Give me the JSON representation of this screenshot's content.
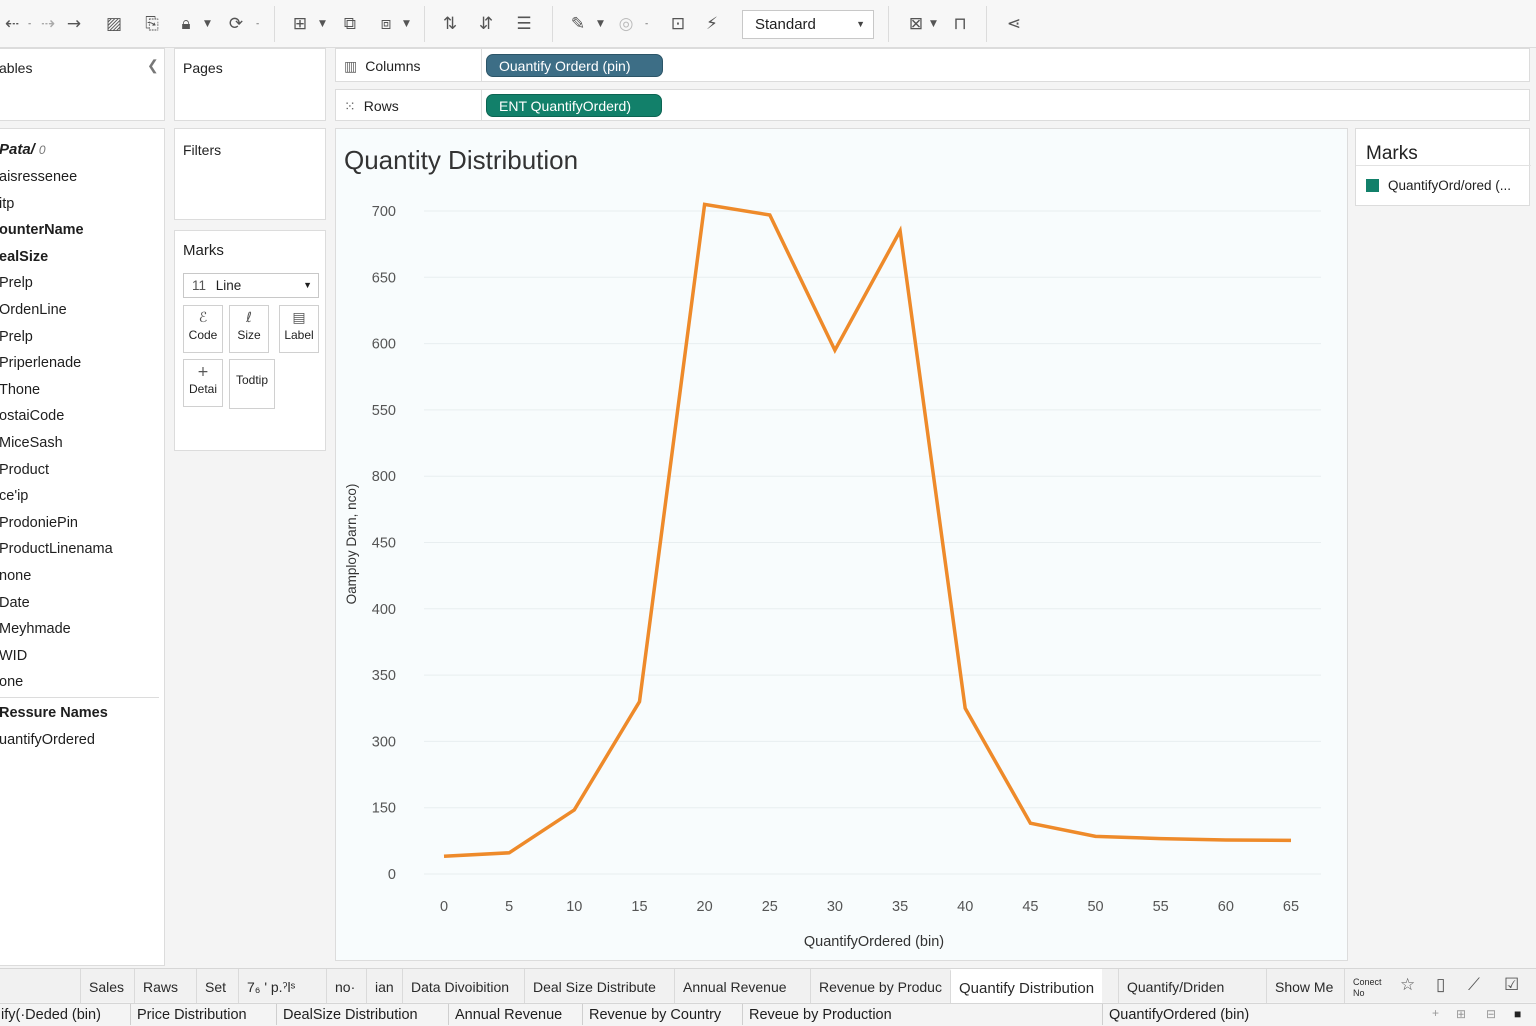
{
  "toolbar": {
    "view_mode": "Standard"
  },
  "data_pane": {
    "title": "ables",
    "section_header": "Pata/",
    "section_suffix": "0",
    "dimensions": [
      {
        "label": "aisressenee",
        "bold": false
      },
      {
        "label": "itp",
        "bold": false
      },
      {
        "label": "ounterName",
        "bold": true
      },
      {
        "label": "ealSize",
        "bold": true
      },
      {
        "label": "Prelp",
        "bold": false
      },
      {
        "label": "OrdenLine",
        "bold": false
      },
      {
        "label": "Prelp",
        "bold": false
      },
      {
        "label": "Priperlenade",
        "bold": false
      },
      {
        "label": "Thone",
        "bold": false
      },
      {
        "label": "ostaiCode",
        "bold": false
      },
      {
        "label": "MiceSash",
        "bold": false
      },
      {
        "label": "Product",
        "bold": false
      },
      {
        "label": "ce'ip",
        "bold": false
      },
      {
        "label": "ProdoniePin",
        "bold": false
      },
      {
        "label": "ProductLinenama",
        "bold": false
      },
      {
        "label": "none",
        "bold": false
      },
      {
        "label": "Date",
        "bold": false
      },
      {
        "label": "Meyhmade",
        "bold": false
      },
      {
        "label": "WID",
        "bold": false
      },
      {
        "label": "one",
        "bold": false
      }
    ],
    "measures_header": "Ressure Names",
    "measures": [
      "uantifyOrdered"
    ]
  },
  "pages_panel": {
    "title": "Pages"
  },
  "filters_panel": {
    "title": "Filters"
  },
  "marks_card": {
    "title": "Marks",
    "mark_type_prefix": "11",
    "mark_type": "Line",
    "buttons": {
      "code": "Code",
      "size": "Size",
      "label": "Label",
      "detail": "Detai",
      "tooltip": "Todtip"
    }
  },
  "shelves": {
    "columns_label": "Columns",
    "columns_pill": "Ouantify Orderd (pin)",
    "rows_label": "Rows",
    "rows_pill": "ENT QuantifyOrderd)"
  },
  "legend": {
    "title": "Marks",
    "item": "QuantifyOrd/ored (...",
    "item_color": "#12806a"
  },
  "colors": {
    "line": "#ee8a2a",
    "pill_columns": "#3d6e86",
    "pill_rows": "#12806a"
  },
  "chart_data": {
    "type": "line",
    "title": "Quantity Distribution",
    "xlabel": "QuantifyOrdered (bin)",
    "ylabel": "Oamploy Darn, nco)",
    "x_ticks": [
      "0",
      "5",
      "10",
      "15",
      "20",
      "25",
      "30",
      "35",
      "40",
      "45",
      "50",
      "55",
      "60",
      "65"
    ],
    "y_ticks": [
      "700",
      "650",
      "600",
      "550",
      "800",
      "450",
      "400",
      "350",
      "300",
      "150",
      "0"
    ],
    "x": [
      0,
      5,
      10,
      15,
      20,
      25,
      30,
      35,
      40,
      45,
      50,
      55,
      60,
      65
    ],
    "values": [
      40,
      48,
      145,
      330,
      705,
      697,
      595,
      685,
      325,
      115,
      85,
      80,
      77,
      76
    ],
    "xlim": [
      0,
      65
    ],
    "grid": true
  },
  "sheet_tabs": [
    {
      "label": "Sales",
      "active": false
    },
    {
      "label": "Raws",
      "active": false
    },
    {
      "label": "Set",
      "active": false
    },
    {
      "label": "7₆ ' p.ˀlˢ",
      "active": false
    },
    {
      "label": "no·",
      "active": false
    },
    {
      "label": "ian",
      "active": false
    },
    {
      "label": "Data Divoibition",
      "active": false
    },
    {
      "label": "Deal Size Distribute",
      "active": false
    },
    {
      "label": "Annual Revenue",
      "active": false
    },
    {
      "label": "Revenue by Produc",
      "active": false
    },
    {
      "label": "Quantify Distribution",
      "active": true
    },
    {
      "label": "Quantify/Driden",
      "active": false
    },
    {
      "label": "Show Me",
      "active": false
    },
    {
      "label": "Conect No",
      "active": false
    }
  ],
  "status_items": [
    "ify(·Deded (bin)",
    "Price Distribution",
    "DealSize Distribution",
    "Annual Revenue",
    "Revenue by Country",
    "Reveue by Production",
    "QuantifyOrdered (bin)"
  ]
}
